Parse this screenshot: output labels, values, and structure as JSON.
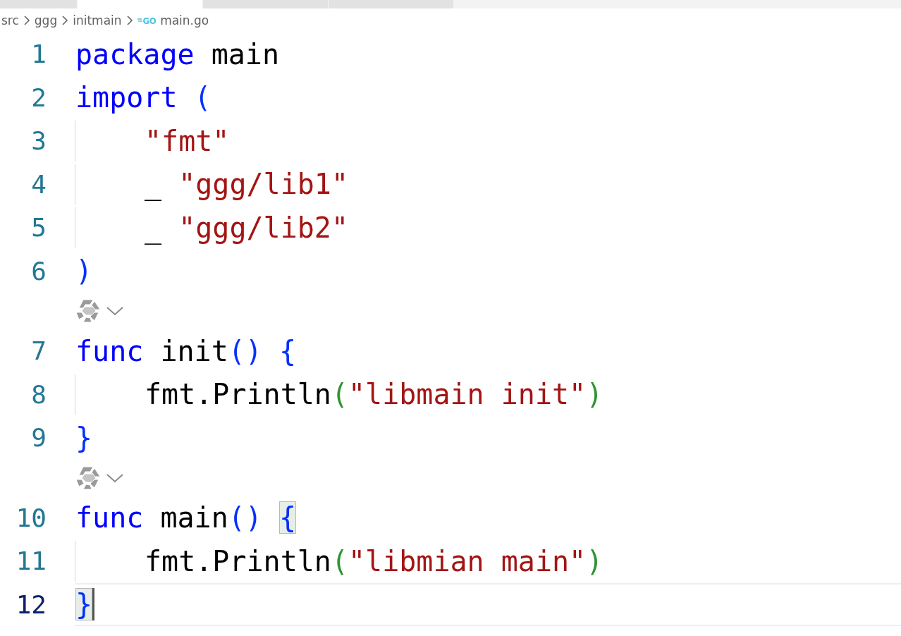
{
  "tabs": [
    {
      "selected": false
    },
    {
      "selected": true
    },
    {
      "selected": false
    },
    {
      "selected": false
    }
  ],
  "breadcrumb": [
    {
      "text": "src"
    },
    {
      "text": "ggg"
    },
    {
      "text": "initmain"
    },
    {
      "text": "main.go",
      "icon_text": "GO"
    }
  ],
  "lines": [
    {
      "kind": "code",
      "number": "1",
      "indent": false,
      "active": false,
      "cursor": false,
      "tokens": [
        {
          "kind": "keyword",
          "text": "package"
        },
        {
          "kind": "plain",
          "text": " main"
        }
      ]
    },
    {
      "kind": "code",
      "number": "2",
      "indent": false,
      "active": false,
      "cursor": false,
      "tokens": [
        {
          "kind": "keyword",
          "text": "import"
        },
        {
          "kind": "bracket",
          "text": " ("
        }
      ]
    },
    {
      "kind": "code",
      "number": "3",
      "indent": true,
      "active": false,
      "cursor": false,
      "tokens": [
        {
          "kind": "string",
          "text": "\"fmt\""
        }
      ]
    },
    {
      "kind": "code",
      "number": "4",
      "indent": true,
      "active": false,
      "cursor": false,
      "tokens": [
        {
          "kind": "plain",
          "text": "_ "
        },
        {
          "kind": "string",
          "text": "\"ggg/lib1\""
        }
      ]
    },
    {
      "kind": "code",
      "number": "5",
      "indent": true,
      "active": false,
      "cursor": false,
      "tokens": [
        {
          "kind": "plain",
          "text": "_ "
        },
        {
          "kind": "string",
          "text": "\"ggg/lib2\""
        }
      ]
    },
    {
      "kind": "code",
      "number": "6",
      "indent": false,
      "active": false,
      "cursor": false,
      "tokens": [
        {
          "kind": "bracket",
          "text": ")"
        }
      ]
    },
    {
      "kind": "lens"
    },
    {
      "kind": "code",
      "number": "7",
      "indent": false,
      "active": false,
      "cursor": false,
      "tokens": [
        {
          "kind": "keyword",
          "text": "func"
        },
        {
          "kind": "plain",
          "text": " init"
        },
        {
          "kind": "bracket",
          "text": "() "
        },
        {
          "kind": "bracket",
          "text": "{"
        }
      ]
    },
    {
      "kind": "code",
      "number": "8",
      "indent": true,
      "active": false,
      "cursor": false,
      "tokens": [
        {
          "kind": "plain",
          "text": "fmt.Println"
        },
        {
          "kind": "bracket2",
          "text": "("
        },
        {
          "kind": "string",
          "text": "\"libmain init\""
        },
        {
          "kind": "bracket2",
          "text": ")"
        }
      ]
    },
    {
      "kind": "code",
      "number": "9",
      "indent": false,
      "active": false,
      "cursor": false,
      "tokens": [
        {
          "kind": "bracket",
          "text": "}"
        }
      ]
    },
    {
      "kind": "lens"
    },
    {
      "kind": "code",
      "number": "10",
      "indent": false,
      "active": false,
      "cursor": false,
      "tokens": [
        {
          "kind": "keyword",
          "text": "func"
        },
        {
          "kind": "plain",
          "text": " main"
        },
        {
          "kind": "bracket",
          "text": "() "
        },
        {
          "kind": "bracket",
          "text": "{",
          "matched": true
        }
      ]
    },
    {
      "kind": "code",
      "number": "11",
      "indent": true,
      "active": false,
      "cursor": false,
      "tokens": [
        {
          "kind": "plain",
          "text": "fmt.Println"
        },
        {
          "kind": "bracket2",
          "text": "("
        },
        {
          "kind": "string",
          "text": "\"libmian main\""
        },
        {
          "kind": "bracket2",
          "text": ")"
        }
      ]
    },
    {
      "kind": "code",
      "number": "12",
      "indent": false,
      "active": true,
      "cursor": true,
      "tokens": [
        {
          "kind": "bracket",
          "text": "}",
          "matched": true
        }
      ]
    }
  ]
}
